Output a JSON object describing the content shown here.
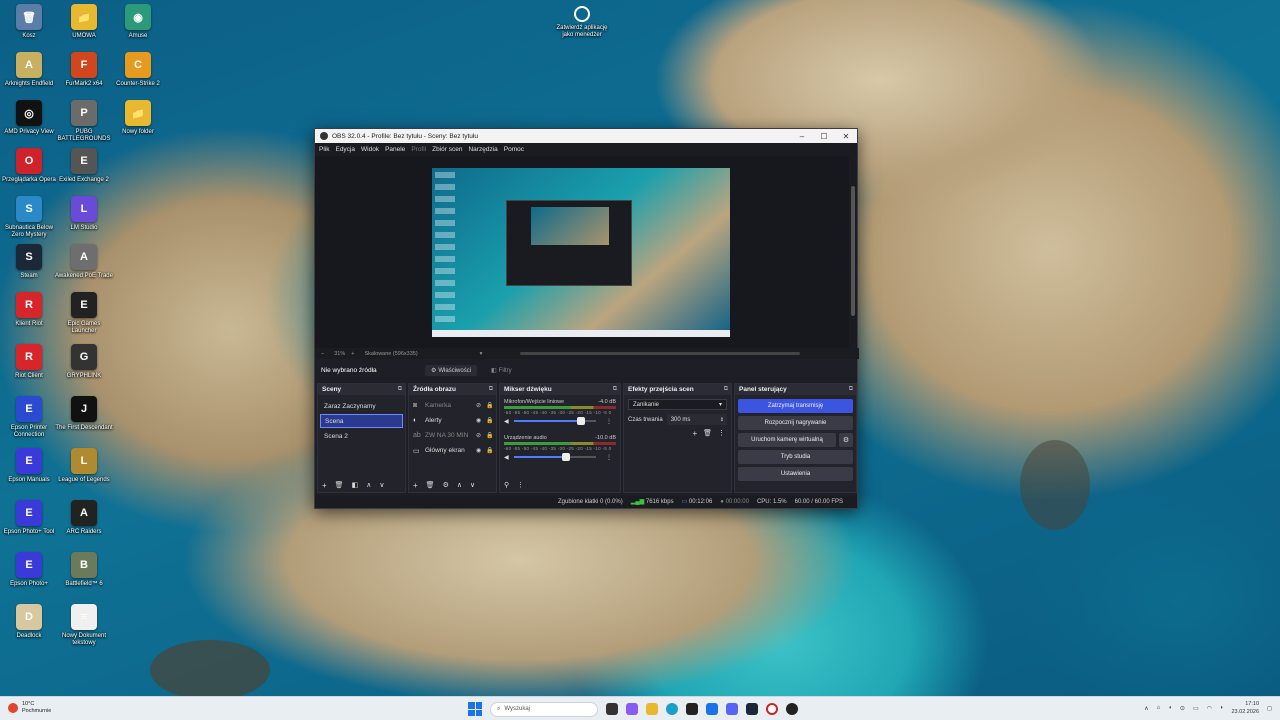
{
  "desktop": {
    "icons": [
      {
        "label": "Kosz",
        "glyph": "🗑",
        "color": "#5a7ea8"
      },
      {
        "label": "UMOWA",
        "glyph": "📁",
        "color": "#e8b82e"
      },
      {
        "label": "Amuse",
        "glyph": "◉",
        "color": "#2a9a7a"
      },
      {
        "label": "Arknights Endfield",
        "glyph": "A",
        "color": "#c8b060"
      },
      {
        "label": "FurMark2 x64",
        "glyph": "F",
        "color": "#d2461e"
      },
      {
        "label": "Counter-Strike 2",
        "glyph": "C",
        "color": "#e69a1e"
      },
      {
        "label": "AMD Privacy View",
        "glyph": "◎",
        "color": "#111111"
      },
      {
        "label": "PUBG BATTLEGROUNDS",
        "glyph": "P",
        "color": "#6b6b6b"
      },
      {
        "label": "Nowy folder",
        "glyph": "📁",
        "color": "#e8b82e"
      },
      {
        "label": "Przeglądarka Opera",
        "glyph": "O",
        "color": "#d0222a"
      },
      {
        "label": "Exiled Exchange 2",
        "glyph": "E",
        "color": "#555555"
      },
      {
        "label": "Subnautica Below Zero Mystery",
        "glyph": "S",
        "color": "#2a8ac8"
      },
      {
        "label": "LM Studio",
        "glyph": "L",
        "color": "#6a4ad8"
      },
      {
        "label": "Steam",
        "glyph": "S",
        "color": "#1b2838"
      },
      {
        "label": "Awakened PoE Trade",
        "glyph": "A",
        "color": "#6e6e6e"
      },
      {
        "label": "Klient Riot",
        "glyph": "R",
        "color": "#d6262c"
      },
      {
        "label": "Epic Games Launcher",
        "glyph": "E",
        "color": "#222222"
      },
      {
        "label": "Riot Client",
        "glyph": "R",
        "color": "#d6262c"
      },
      {
        "label": "GRYPHLINK",
        "glyph": "G",
        "color": "#333333"
      },
      {
        "label": "Epson Printer Connection",
        "glyph": "E",
        "color": "#2a4ad0"
      },
      {
        "label": "The First Descendant",
        "glyph": "J",
        "color": "#111111"
      },
      {
        "label": "Epson Manuals",
        "glyph": "E",
        "color": "#3a3ad8"
      },
      {
        "label": "League of Legends",
        "glyph": "L",
        "color": "#b08a2e"
      },
      {
        "label": "Epson Photo+ Tool",
        "glyph": "E",
        "color": "#3a3ad8"
      },
      {
        "label": "ARC Raiders",
        "glyph": "A",
        "color": "#222222"
      },
      {
        "label": "Epson Photo+",
        "glyph": "E",
        "color": "#3a3ad8"
      },
      {
        "label": "Battlefield™ 6",
        "glyph": "B",
        "color": "#6a7a5a"
      },
      {
        "label": "Deadlock",
        "glyph": "D",
        "color": "#d8c8a0"
      },
      {
        "label": "Nowy Dokument tekstowy",
        "glyph": "≡",
        "color": "#f0f0f0"
      }
    ],
    "top_shortcut": "Zatwierdź aplikację jako menedżer"
  },
  "obs": {
    "title": "OBS 32.0.4 - Profile: Bez tytułu - Sceny: Bez tytułu",
    "menu": [
      "Plik",
      "Edycja",
      "Widok",
      "Panele",
      "Profil",
      "Zbiór scen",
      "Narzędzia",
      "Pomoc"
    ],
    "zoom": "31%",
    "scaled_label": "Skalowane (596x335)",
    "no_source": "Nie wybrano źródła",
    "properties": "Właściwości",
    "filters": "Filtry",
    "docks": {
      "scenes": {
        "title": "Sceny",
        "items": [
          "Zaraz Zaczynamy",
          "Scena",
          "Scena 2"
        ],
        "selected": 1
      },
      "sources": {
        "title": "Źródła obrazu",
        "items": [
          {
            "label": "Kamerka",
            "icon": "camera-icon",
            "glyph": "◙",
            "visible": false
          },
          {
            "label": "Alerty",
            "icon": "globe-icon",
            "glyph": "◐",
            "visible": true
          },
          {
            "label": "ZW NA 30 MIN",
            "icon": "text-icon",
            "glyph": "ab",
            "visible": false
          },
          {
            "label": "Główny ekran",
            "icon": "display-icon",
            "glyph": "▭",
            "visible": true
          }
        ]
      },
      "mixer": {
        "title": "Mikser dźwięku",
        "channels": [
          {
            "name": "Mikrofon/Wejście liniowe",
            "db": "-4.0 dB",
            "level": 0.82
          },
          {
            "name": "Urządzenie audio",
            "db": "-10.0 dB",
            "level": 0.64
          }
        ],
        "scale": "-60 -55 -50 -45 -40 -35 -30 -25 -20 -15 -10 -5 0"
      },
      "transitions": {
        "title": "Efekty przejścia scen",
        "selected": "Zanikanie",
        "duration_label": "Czas trwania",
        "duration": "300 ms"
      },
      "controls": {
        "title": "Panel sterujący",
        "stop_stream": "Zatrzymaj transmisję",
        "start_record": "Rozpocznij nagrywanie",
        "virtual_cam": "Uruchom kamerę wirtualną",
        "studio_mode": "Tryb studia",
        "settings": "Ustawienia"
      }
    },
    "status": {
      "dropped": "Zgubione klatki 0 (0.0%)",
      "kbps": "7616 kbps",
      "stream_time": "00:12:06",
      "rec_time": "00:00:00",
      "cpu": "CPU: 1.5%",
      "fps": "60.00 / 60.00 FPS"
    }
  },
  "taskbar": {
    "weather_temp": "10°C",
    "weather_desc": "Pochmurnie",
    "search_placeholder": "Wyszukaj",
    "time": "17:10",
    "date": "23.02.2026"
  }
}
